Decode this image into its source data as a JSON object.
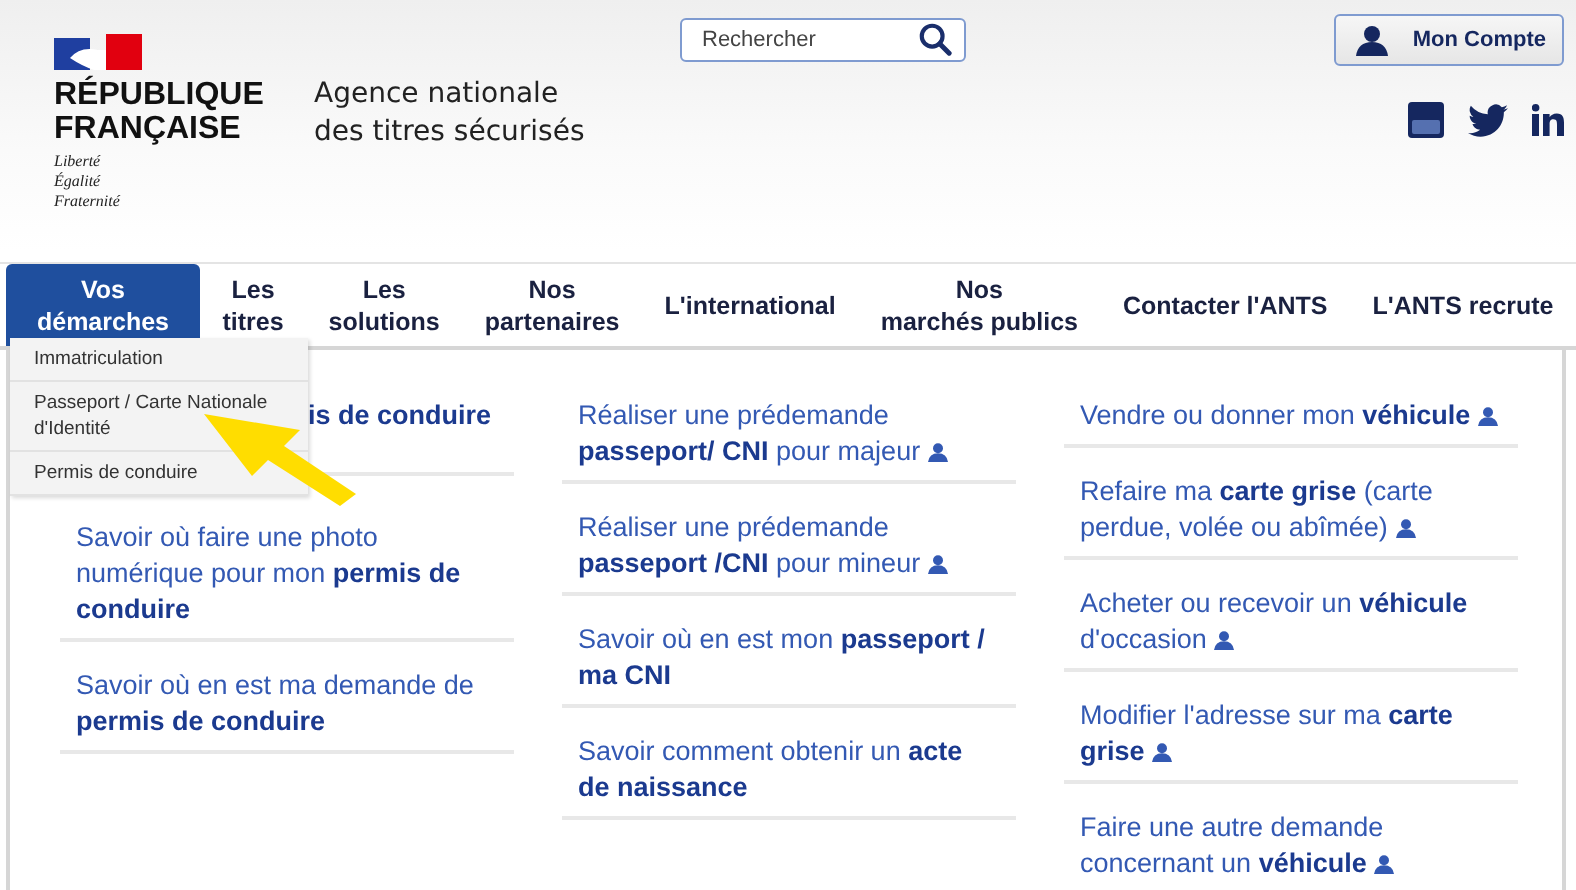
{
  "header": {
    "republic": [
      "RÉPUBLIQUE",
      "FRANÇAISE"
    ],
    "motto": [
      "Liberté",
      "Égalité",
      "Fraternité"
    ],
    "agency": [
      "Agence nationale",
      "des titres sécurisés"
    ],
    "search": {
      "placeholder": "Rechercher"
    },
    "account_button": "Mon Compte"
  },
  "nav": [
    {
      "label": [
        "Vos",
        "démarches"
      ],
      "selected": true
    },
    {
      "label": [
        "Les",
        "titres"
      ],
      "selected": false
    },
    {
      "label": [
        "Les",
        "solutions"
      ],
      "selected": false
    },
    {
      "label": [
        "Nos",
        "partenaires"
      ],
      "selected": false
    },
    {
      "label": [
        "L'international"
      ],
      "selected": false
    },
    {
      "label": [
        "Nos",
        "marchés publics"
      ],
      "selected": false
    },
    {
      "label": [
        "Contacter l'ANTS"
      ],
      "selected": false
    },
    {
      "label": [
        "L'ANTS recrute"
      ],
      "selected": false
    }
  ],
  "dropdown": [
    "Immatriculation",
    "Passeport / Carte Nationale d'Identité",
    "Permis de conduire"
  ],
  "columns": [
    [
      {
        "text": "**is de conduire**",
        "kind": "covered",
        "account": false
      },
      {
        "text": "Savoir où faire une photo numérique pour mon **permis de conduire**",
        "kind": "plain",
        "account": false
      },
      {
        "text": "Savoir où en est ma demande de **permis de conduire**",
        "kind": "plain",
        "account": false
      }
    ],
    [
      {
        "text": "Réaliser une prédemande **passeport/ CNI** pour majeur",
        "kind": "plain",
        "account": true
      },
      {
        "text": "Réaliser une prédemande **passeport /CNI** pour mineur",
        "kind": "plain",
        "account": true
      },
      {
        "text": "Savoir où en est mon **passeport / ma CNI**",
        "kind": "plain",
        "account": false
      },
      {
        "text": "Savoir comment obtenir un **acte de naissance**",
        "kind": "plain",
        "account": false
      }
    ],
    [
      {
        "text": "Vendre ou donner mon **véhicule**",
        "kind": "plain",
        "account": true
      },
      {
        "text": "Refaire ma **carte grise** (carte perdue, volée ou abîmée)",
        "kind": "plain",
        "account": true
      },
      {
        "text": "Acheter ou recevoir un **véhicule** d'occasion",
        "kind": "plain",
        "account": true
      },
      {
        "text": "Modifier l'adresse sur ma **carte grise**",
        "kind": "plain",
        "account": true
      },
      {
        "text": "Faire une autre demande concernant un **véhicule**",
        "kind": "plain",
        "account": true
      }
    ]
  ]
}
